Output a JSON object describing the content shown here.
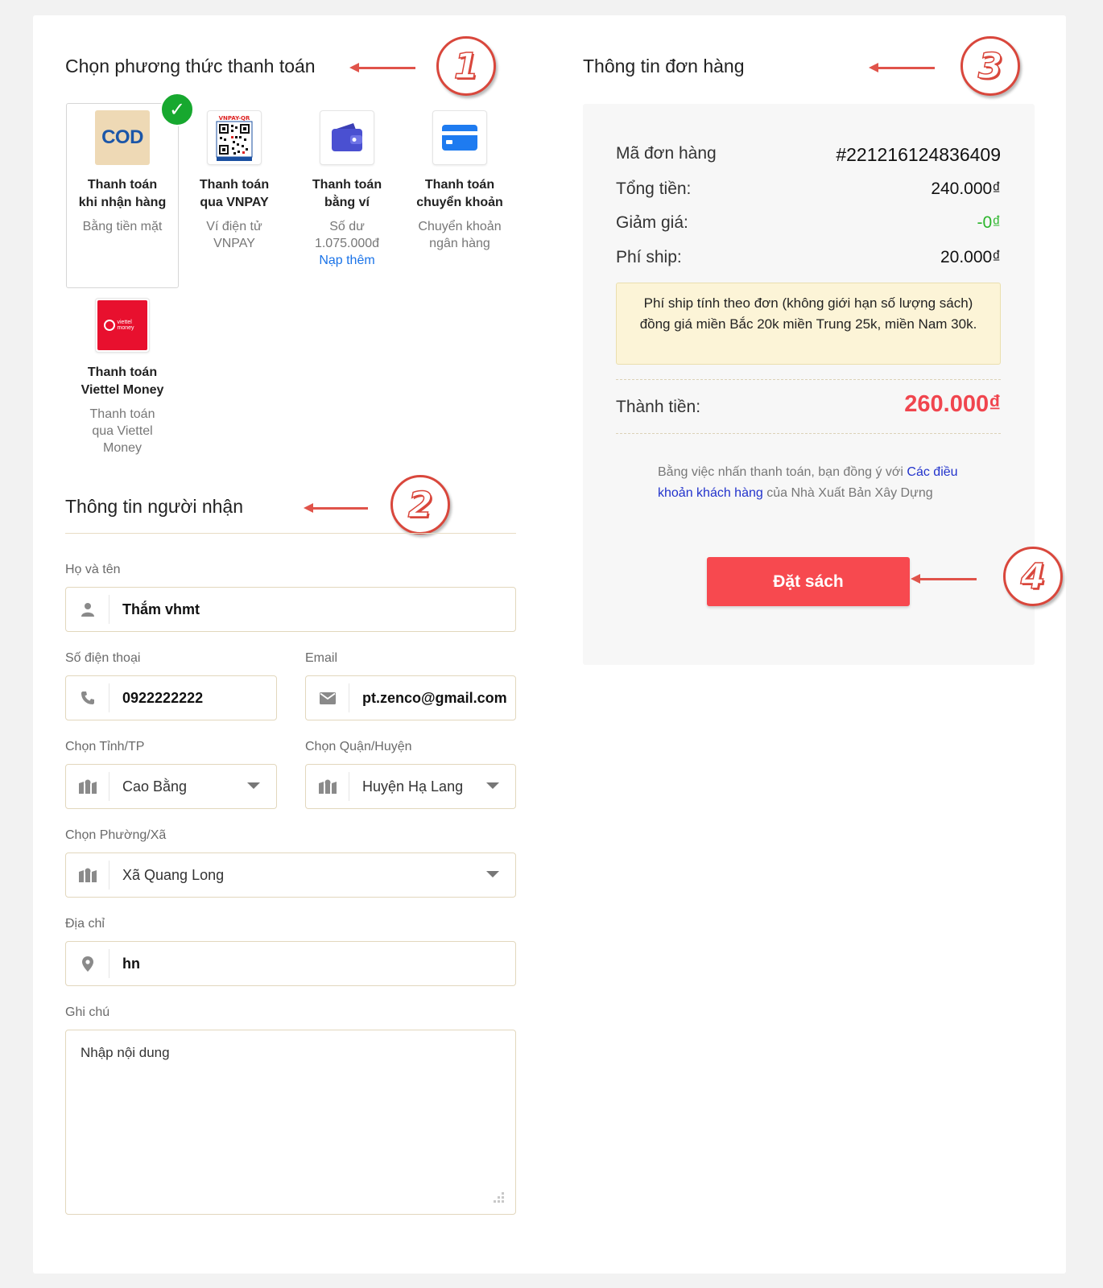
{
  "payment": {
    "title": "Chọn phương thức thanh toán",
    "methods": [
      {
        "icon": "cod-icon",
        "icon_text": "COD",
        "title_line1": "Thanh toán",
        "title_line2": "khi nhận hàng",
        "sub": "Bằng tiền mặt",
        "selected": true
      },
      {
        "icon": "vnpay-qr-icon",
        "icon_text": "VNPAY-QR",
        "title_line1": "Thanh toán",
        "title_line2": "qua VNPAY",
        "sub": "Ví điện tử VNPAY"
      },
      {
        "icon": "wallet-icon",
        "title_line1": "Thanh toán",
        "title_line2": "bằng ví",
        "sub": "Số dư 1.075.000đ",
        "link": "Nạp thêm"
      },
      {
        "icon": "bank-card-icon",
        "title_line1": "Thanh toán",
        "title_line2": "chuyển khoản",
        "sub": "Chuyển khoản ngân hàng"
      },
      {
        "icon": "viettel-money-icon",
        "icon_text": "viettel money",
        "title_line1": "Thanh toán",
        "title_line2": "Viettel Money",
        "sub": "Thanh toán qua Viettel Money"
      }
    ]
  },
  "recipient": {
    "title": "Thông tin người nhận",
    "name_label": "Họ và tên",
    "name_value": "Thắm vhmt",
    "phone_label": "Số điện thoại",
    "phone_value": "0922222222",
    "email_label": "Email",
    "email_value": "pt.zenco@gmail.com",
    "province_label": "Chọn Tỉnh/TP",
    "province_value": "Cao Bằng",
    "district_label": "Chọn Quận/Huyện",
    "district_value": "Huyện Hạ Lang",
    "ward_label": "Chọn Phường/Xã",
    "ward_value": "Xã Quang Long",
    "address_label": "Địa chỉ",
    "address_value": "hn",
    "note_label": "Ghi chú",
    "note_placeholder": "Nhập nội dung"
  },
  "order": {
    "title": "Thông tin đơn hàng",
    "code_label": "Mã đơn hàng",
    "code_value": "#221216124836409",
    "total_label": "Tổng tiền:",
    "total_value": "240.000₫",
    "discount_label": "Giảm giá:",
    "discount_value": "-0₫",
    "ship_label": "Phí ship:",
    "ship_value": "20.000₫",
    "ship_note": "Phí ship tính theo đơn (không giới hạn số lượng sách) đồng giá miền Bắc 20k miền Trung 25k, miền Nam 30k.",
    "grand_label": "Thành tiền:",
    "grand_value": "260.000₫",
    "terms_prefix": "Bằng việc nhấn thanh toán, bạn đồng ý với ",
    "terms_link": "Các điều khoản khách hàng",
    "terms_suffix": " của Nhà Xuất Bản Xây Dựng",
    "button": "Đặt sách"
  },
  "annotations": {
    "step1": "1",
    "step2": "2",
    "step3": "3",
    "step4": "4",
    "color": "#d9473c"
  },
  "colors": {
    "accent_red": "#f7494f",
    "success_green": "#17a82f",
    "link_blue": "#1a73e8",
    "note_bg": "#fcf4d7"
  }
}
